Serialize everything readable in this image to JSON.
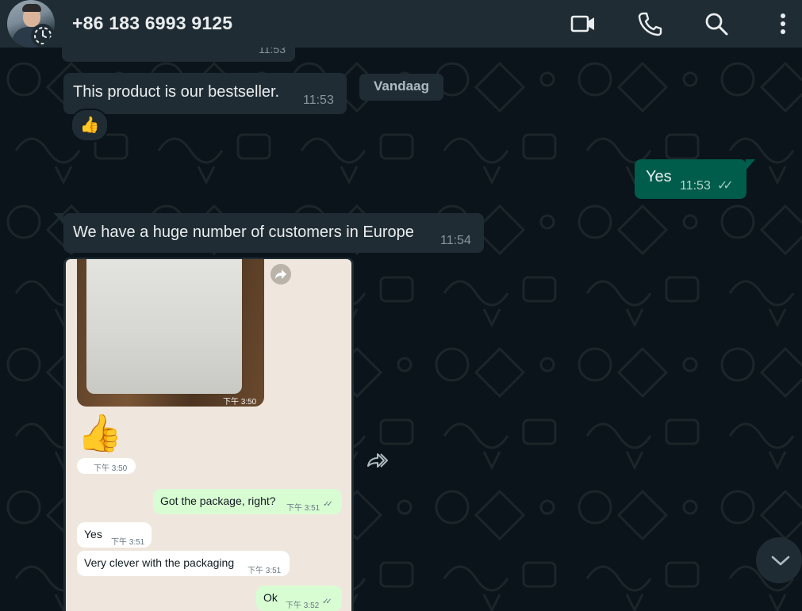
{
  "header": {
    "contact": "+86 183 6993 9125",
    "icons": [
      "video-call-icon",
      "voice-call-icon",
      "search-icon",
      "menu-icon"
    ]
  },
  "chat": {
    "top_partial_time": "11:53",
    "date_chip": "Vandaag",
    "messages": [
      {
        "dir": "in",
        "text": "This product is our bestseller.",
        "time": "11:53",
        "reaction": "👍"
      },
      {
        "dir": "out",
        "text": "Yes",
        "time": "11:53",
        "ticks": "✓✓"
      },
      {
        "dir": "in",
        "text": "We have a huge number of customers in Europe",
        "time": "11:54"
      }
    ],
    "forwarded_screenshot": {
      "photo_time": "下午 3:50",
      "emoji": "👍",
      "emoji_time": "下午 3:50",
      "items": [
        {
          "dir": "out",
          "text": "Got the package, right?",
          "time": "下午 3:51",
          "ticks": "✓✓"
        },
        {
          "dir": "in",
          "text": "Yes",
          "time": "下午 3:51"
        },
        {
          "dir": "in",
          "text": "Very clever with the packaging",
          "time": "下午 3:51"
        },
        {
          "dir": "out",
          "text": "Ok",
          "time": "下午 3:52",
          "ticks": "✓✓"
        }
      ]
    }
  },
  "colors": {
    "header_bg": "#202c33",
    "chat_bg": "#0b141a",
    "incoming": "#202c33",
    "outgoing": "#005c4b"
  }
}
